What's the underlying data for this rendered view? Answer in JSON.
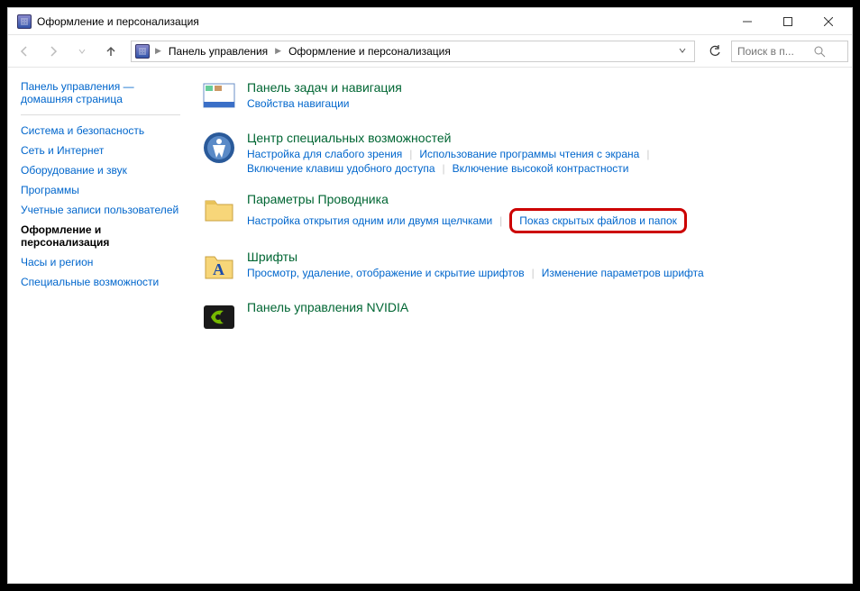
{
  "window": {
    "title": "Оформление и персонализация"
  },
  "breadcrumb": {
    "root": "Панель управления",
    "current": "Оформление и персонализация"
  },
  "search": {
    "placeholder": "Поиск в п..."
  },
  "sidebar": {
    "home": "Панель управления — домашняя страница",
    "items": [
      "Система и безопасность",
      "Сеть и Интернет",
      "Оборудование и звук",
      "Программы",
      "Учетные записи пользователей",
      "Оформление и персонализация",
      "Часы и регион",
      "Специальные возможности"
    ]
  },
  "categories": [
    {
      "title": "Панель задач и навигация",
      "links": [
        "Свойства навигации"
      ]
    },
    {
      "title": "Центр специальных возможностей",
      "links": [
        "Настройка для слабого зрения",
        "Использование программы чтения с экрана",
        "Включение клавиш удобного доступа",
        "Включение высокой контрастности"
      ]
    },
    {
      "title": "Параметры Проводника",
      "links": [
        "Настройка открытия одним или двумя щелчками",
        "Показ скрытых файлов и папок"
      ],
      "highlight_index": 1
    },
    {
      "title": "Шрифты",
      "links": [
        "Просмотр, удаление, отображение и скрытие шрифтов",
        "Изменение параметров шрифта"
      ]
    },
    {
      "title": "Панель управления NVIDIA",
      "links": []
    }
  ]
}
